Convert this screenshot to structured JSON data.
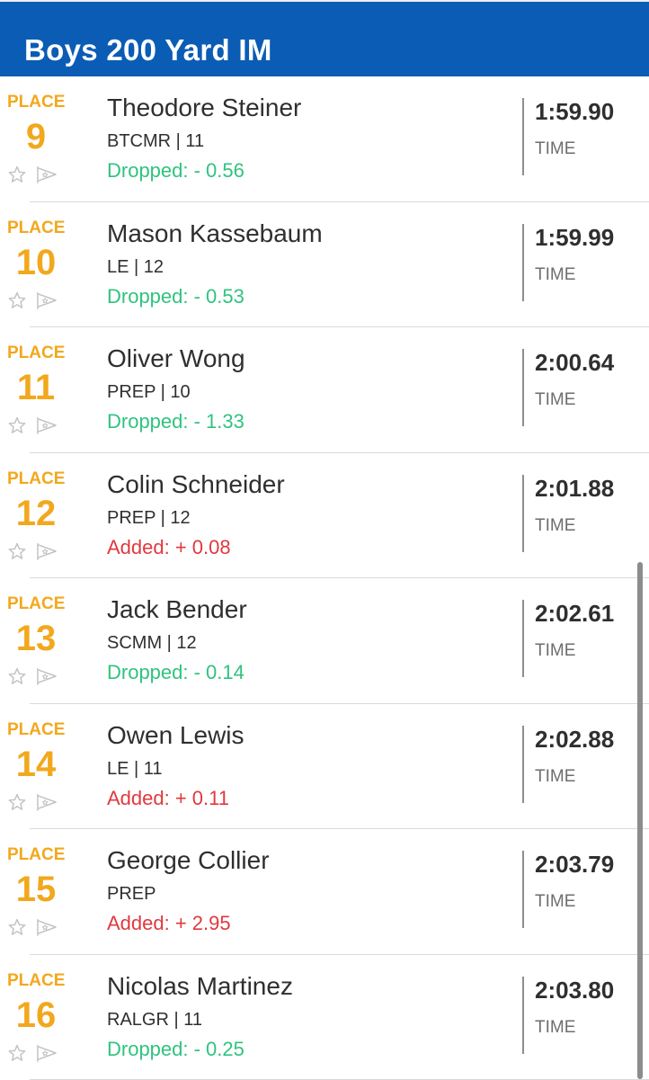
{
  "header": {
    "title": "Boys 200 Yard IM"
  },
  "results": [
    {
      "place_label": "PLACE",
      "place": "9",
      "name": "Theodore Steiner",
      "team": "BTCMR | 11",
      "change": "Dropped: - 0.56",
      "change_type": "dropped",
      "time": "1:59.90",
      "time_label": "TIME"
    },
    {
      "place_label": "PLACE",
      "place": "10",
      "name": "Mason Kassebaum",
      "team": "LE | 12",
      "change": "Dropped: - 0.53",
      "change_type": "dropped",
      "time": "1:59.99",
      "time_label": "TIME"
    },
    {
      "place_label": "PLACE",
      "place": "11",
      "name": "Oliver Wong",
      "team": "PREP | 10",
      "change": "Dropped: - 1.33",
      "change_type": "dropped",
      "time": "2:00.64",
      "time_label": "TIME"
    },
    {
      "place_label": "PLACE",
      "place": "12",
      "name": "Colin Schneider",
      "team": "PREP | 12",
      "change": "Added: + 0.08",
      "change_type": "added",
      "time": "2:01.88",
      "time_label": "TIME"
    },
    {
      "place_label": "PLACE",
      "place": "13",
      "name": "Jack Bender",
      "team": "SCMM | 12",
      "change": "Dropped: - 0.14",
      "change_type": "dropped",
      "time": "2:02.61",
      "time_label": "TIME"
    },
    {
      "place_label": "PLACE",
      "place": "14",
      "name": "Owen Lewis",
      "team": "LE | 11",
      "change": "Added: + 0.11",
      "change_type": "added",
      "time": "2:02.88",
      "time_label": "TIME"
    },
    {
      "place_label": "PLACE",
      "place": "15",
      "name": "George Collier",
      "team": "PREP",
      "change": "Added: + 2.95",
      "change_type": "added",
      "time": "2:03.79",
      "time_label": "TIME"
    },
    {
      "place_label": "PLACE",
      "place": "16",
      "name": "Nicolas Martinez",
      "team": "RALGR | 11",
      "change": "Dropped: - 0.25",
      "change_type": "dropped",
      "time": "2:03.80",
      "time_label": "TIME"
    }
  ],
  "icons": {
    "favorite": "star-outline-icon",
    "flag": "flag-outline-icon"
  },
  "colors": {
    "header_bg": "#0b5cb4",
    "place": "#f2a81d",
    "dropped": "#2fc37f",
    "added": "#e0393e"
  }
}
